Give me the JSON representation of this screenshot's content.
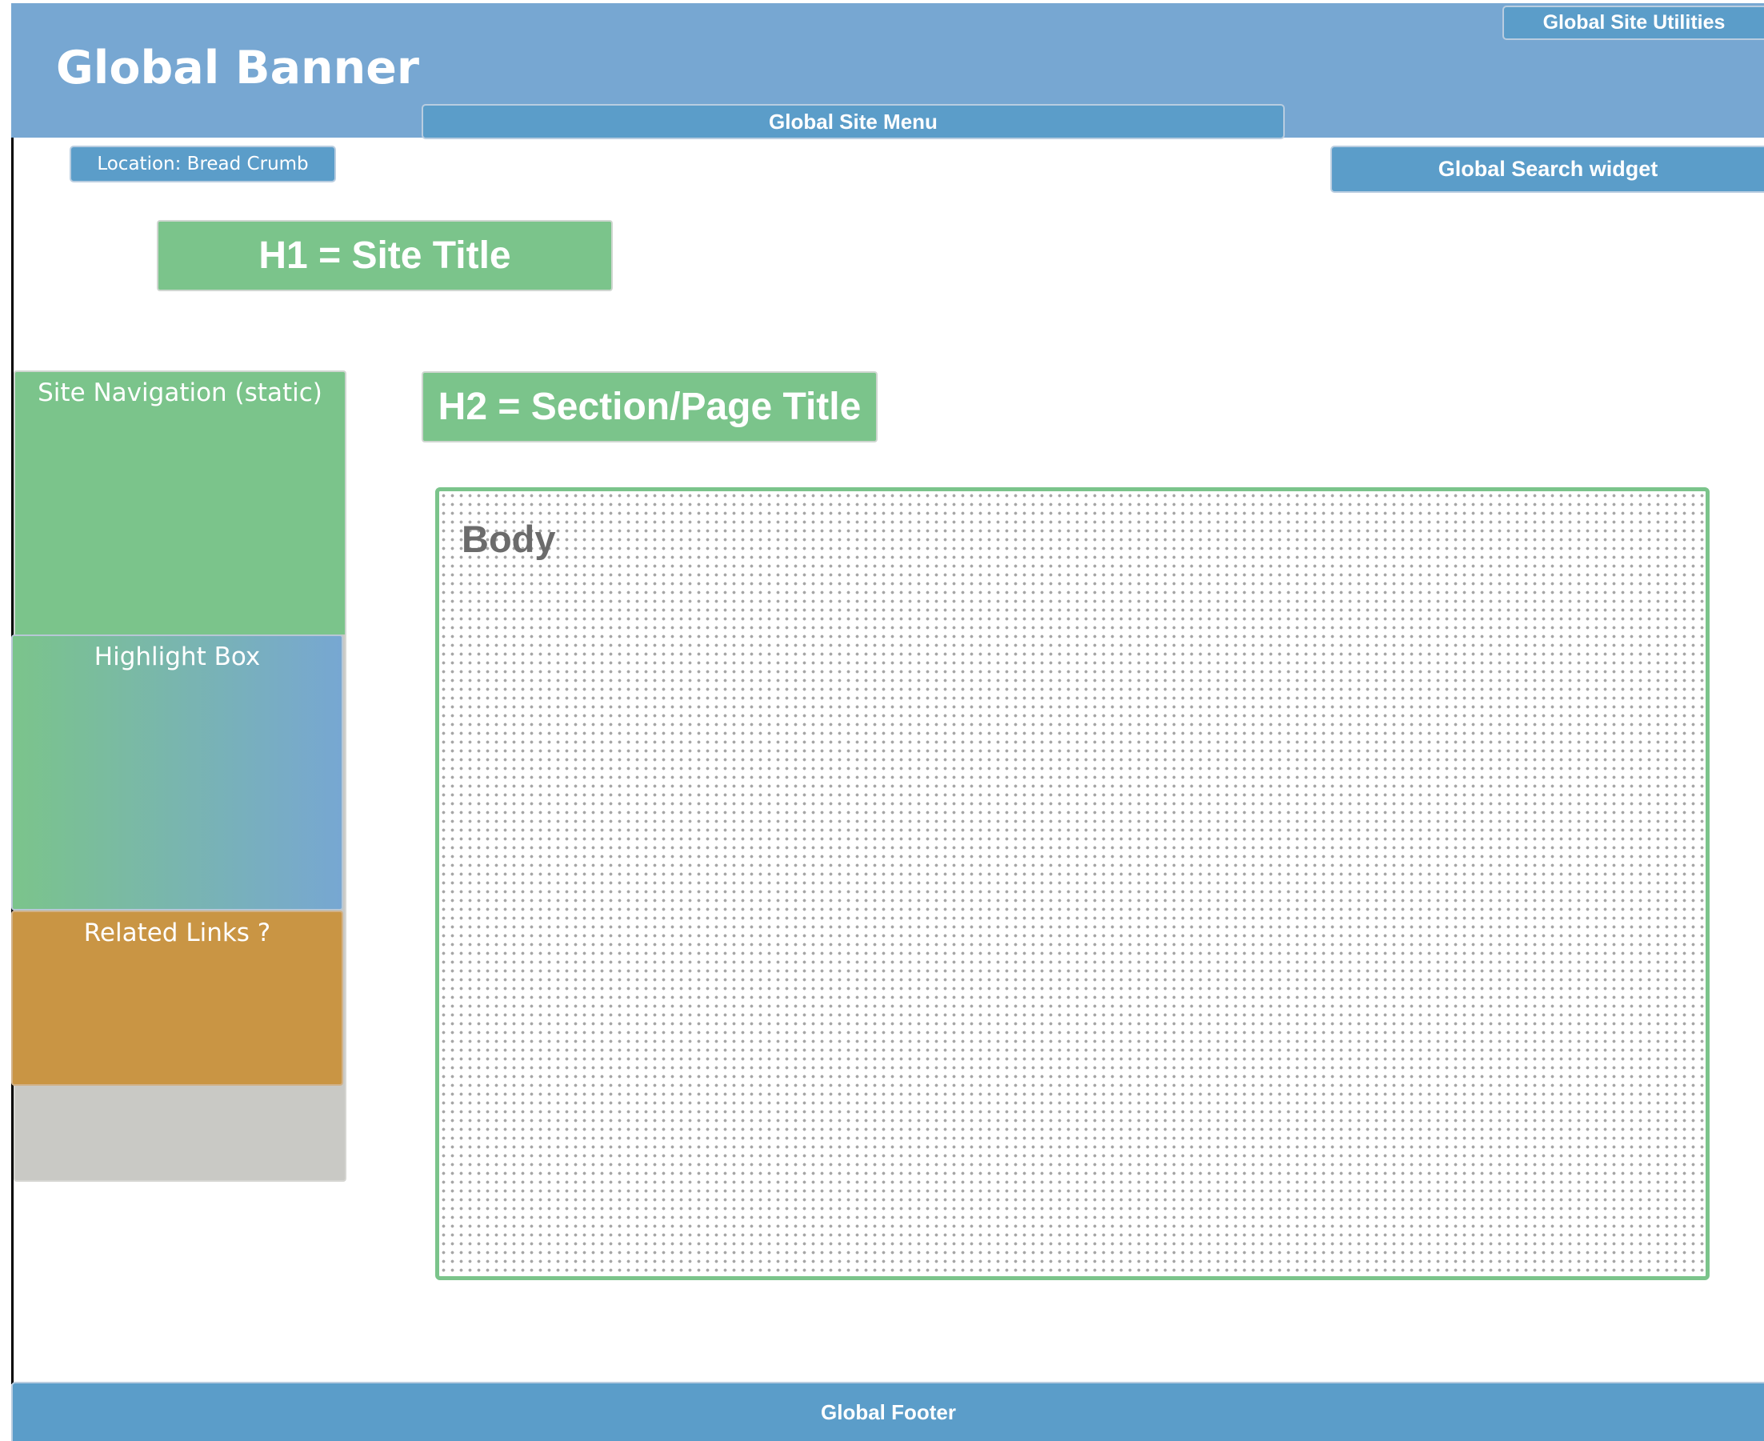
{
  "banner": {
    "title": "Global Banner",
    "utilities_label": "Global Site Utilities",
    "menu_label": "Global Site Menu"
  },
  "breadcrumb": {
    "label": "Location: Bread Crumb"
  },
  "search": {
    "label": "Global Search widget"
  },
  "headings": {
    "h1": "H1 = Site Title",
    "h2": "H2 = Section/Page Title"
  },
  "sidebar": {
    "navigation": "Site Navigation (static)",
    "highlight": "Highlight Box",
    "related": "Related Links ?"
  },
  "body": {
    "label": "Body"
  },
  "footer": {
    "label": "Global Footer"
  },
  "colors": {
    "banner_blue": "#77a7d2",
    "widget_blue": "#5b9dc9",
    "green": "#7bc48b",
    "orange": "#c99544",
    "gray": "#c9c9c5"
  }
}
